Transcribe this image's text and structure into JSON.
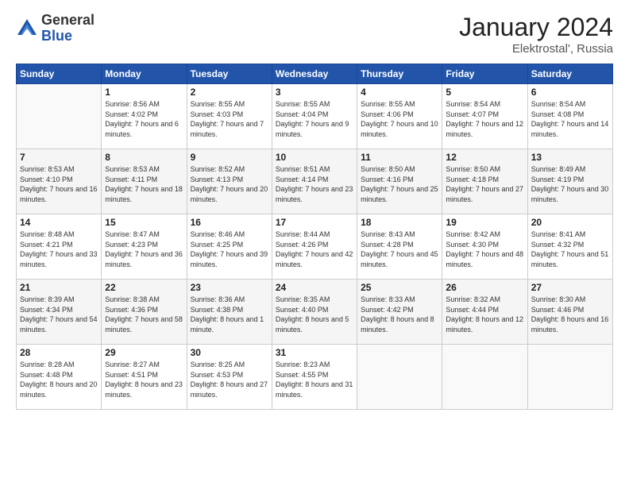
{
  "header": {
    "logo_general": "General",
    "logo_blue": "Blue",
    "month_title": "January 2024",
    "location": "Elektrostal', Russia"
  },
  "weekdays": [
    "Sunday",
    "Monday",
    "Tuesday",
    "Wednesday",
    "Thursday",
    "Friday",
    "Saturday"
  ],
  "weeks": [
    [
      {
        "day": "",
        "sunrise": "",
        "sunset": "",
        "daylight": ""
      },
      {
        "day": "1",
        "sunrise": "Sunrise: 8:56 AM",
        "sunset": "Sunset: 4:02 PM",
        "daylight": "Daylight: 7 hours and 6 minutes."
      },
      {
        "day": "2",
        "sunrise": "Sunrise: 8:55 AM",
        "sunset": "Sunset: 4:03 PM",
        "daylight": "Daylight: 7 hours and 7 minutes."
      },
      {
        "day": "3",
        "sunrise": "Sunrise: 8:55 AM",
        "sunset": "Sunset: 4:04 PM",
        "daylight": "Daylight: 7 hours and 9 minutes."
      },
      {
        "day": "4",
        "sunrise": "Sunrise: 8:55 AM",
        "sunset": "Sunset: 4:06 PM",
        "daylight": "Daylight: 7 hours and 10 minutes."
      },
      {
        "day": "5",
        "sunrise": "Sunrise: 8:54 AM",
        "sunset": "Sunset: 4:07 PM",
        "daylight": "Daylight: 7 hours and 12 minutes."
      },
      {
        "day": "6",
        "sunrise": "Sunrise: 8:54 AM",
        "sunset": "Sunset: 4:08 PM",
        "daylight": "Daylight: 7 hours and 14 minutes."
      }
    ],
    [
      {
        "day": "7",
        "sunrise": "Sunrise: 8:53 AM",
        "sunset": "Sunset: 4:10 PM",
        "daylight": "Daylight: 7 hours and 16 minutes."
      },
      {
        "day": "8",
        "sunrise": "Sunrise: 8:53 AM",
        "sunset": "Sunset: 4:11 PM",
        "daylight": "Daylight: 7 hours and 18 minutes."
      },
      {
        "day": "9",
        "sunrise": "Sunrise: 8:52 AM",
        "sunset": "Sunset: 4:13 PM",
        "daylight": "Daylight: 7 hours and 20 minutes."
      },
      {
        "day": "10",
        "sunrise": "Sunrise: 8:51 AM",
        "sunset": "Sunset: 4:14 PM",
        "daylight": "Daylight: 7 hours and 23 minutes."
      },
      {
        "day": "11",
        "sunrise": "Sunrise: 8:50 AM",
        "sunset": "Sunset: 4:16 PM",
        "daylight": "Daylight: 7 hours and 25 minutes."
      },
      {
        "day": "12",
        "sunrise": "Sunrise: 8:50 AM",
        "sunset": "Sunset: 4:18 PM",
        "daylight": "Daylight: 7 hours and 27 minutes."
      },
      {
        "day": "13",
        "sunrise": "Sunrise: 8:49 AM",
        "sunset": "Sunset: 4:19 PM",
        "daylight": "Daylight: 7 hours and 30 minutes."
      }
    ],
    [
      {
        "day": "14",
        "sunrise": "Sunrise: 8:48 AM",
        "sunset": "Sunset: 4:21 PM",
        "daylight": "Daylight: 7 hours and 33 minutes."
      },
      {
        "day": "15",
        "sunrise": "Sunrise: 8:47 AM",
        "sunset": "Sunset: 4:23 PM",
        "daylight": "Daylight: 7 hours and 36 minutes."
      },
      {
        "day": "16",
        "sunrise": "Sunrise: 8:46 AM",
        "sunset": "Sunset: 4:25 PM",
        "daylight": "Daylight: 7 hours and 39 minutes."
      },
      {
        "day": "17",
        "sunrise": "Sunrise: 8:44 AM",
        "sunset": "Sunset: 4:26 PM",
        "daylight": "Daylight: 7 hours and 42 minutes."
      },
      {
        "day": "18",
        "sunrise": "Sunrise: 8:43 AM",
        "sunset": "Sunset: 4:28 PM",
        "daylight": "Daylight: 7 hours and 45 minutes."
      },
      {
        "day": "19",
        "sunrise": "Sunrise: 8:42 AM",
        "sunset": "Sunset: 4:30 PM",
        "daylight": "Daylight: 7 hours and 48 minutes."
      },
      {
        "day": "20",
        "sunrise": "Sunrise: 8:41 AM",
        "sunset": "Sunset: 4:32 PM",
        "daylight": "Daylight: 7 hours and 51 minutes."
      }
    ],
    [
      {
        "day": "21",
        "sunrise": "Sunrise: 8:39 AM",
        "sunset": "Sunset: 4:34 PM",
        "daylight": "Daylight: 7 hours and 54 minutes."
      },
      {
        "day": "22",
        "sunrise": "Sunrise: 8:38 AM",
        "sunset": "Sunset: 4:36 PM",
        "daylight": "Daylight: 7 hours and 58 minutes."
      },
      {
        "day": "23",
        "sunrise": "Sunrise: 8:36 AM",
        "sunset": "Sunset: 4:38 PM",
        "daylight": "Daylight: 8 hours and 1 minute."
      },
      {
        "day": "24",
        "sunrise": "Sunrise: 8:35 AM",
        "sunset": "Sunset: 4:40 PM",
        "daylight": "Daylight: 8 hours and 5 minutes."
      },
      {
        "day": "25",
        "sunrise": "Sunrise: 8:33 AM",
        "sunset": "Sunset: 4:42 PM",
        "daylight": "Daylight: 8 hours and 8 minutes."
      },
      {
        "day": "26",
        "sunrise": "Sunrise: 8:32 AM",
        "sunset": "Sunset: 4:44 PM",
        "daylight": "Daylight: 8 hours and 12 minutes."
      },
      {
        "day": "27",
        "sunrise": "Sunrise: 8:30 AM",
        "sunset": "Sunset: 4:46 PM",
        "daylight": "Daylight: 8 hours and 16 minutes."
      }
    ],
    [
      {
        "day": "28",
        "sunrise": "Sunrise: 8:28 AM",
        "sunset": "Sunset: 4:48 PM",
        "daylight": "Daylight: 8 hours and 20 minutes."
      },
      {
        "day": "29",
        "sunrise": "Sunrise: 8:27 AM",
        "sunset": "Sunset: 4:51 PM",
        "daylight": "Daylight: 8 hours and 23 minutes."
      },
      {
        "day": "30",
        "sunrise": "Sunrise: 8:25 AM",
        "sunset": "Sunset: 4:53 PM",
        "daylight": "Daylight: 8 hours and 27 minutes."
      },
      {
        "day": "31",
        "sunrise": "Sunrise: 8:23 AM",
        "sunset": "Sunset: 4:55 PM",
        "daylight": "Daylight: 8 hours and 31 minutes."
      },
      {
        "day": "",
        "sunrise": "",
        "sunset": "",
        "daylight": ""
      },
      {
        "day": "",
        "sunrise": "",
        "sunset": "",
        "daylight": ""
      },
      {
        "day": "",
        "sunrise": "",
        "sunset": "",
        "daylight": ""
      }
    ]
  ]
}
